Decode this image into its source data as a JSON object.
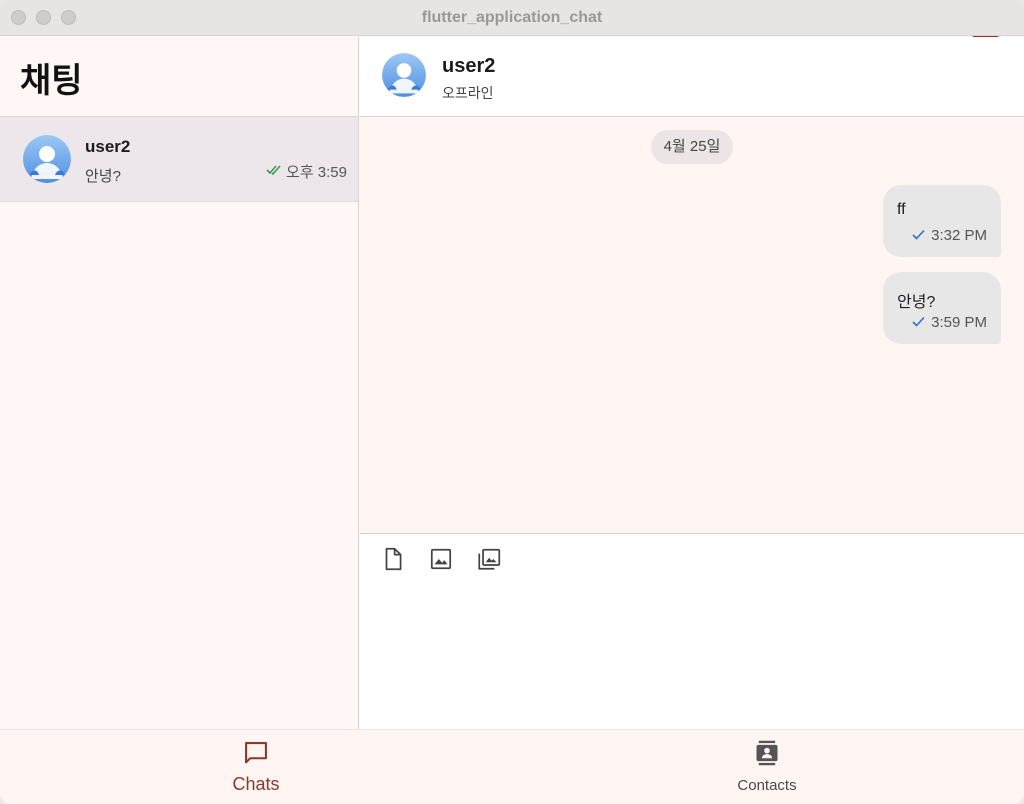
{
  "window": {
    "title": "flutter_application_chat"
  },
  "left_pane": {
    "title": "채팅",
    "chats": [
      {
        "name": "user2",
        "preview": "안녕?",
        "time": "오후 3:59",
        "status_icon": "double-check-icon"
      }
    ]
  },
  "conversation": {
    "name": "user2",
    "status": "오프라인",
    "date_chip": "4월 25일",
    "messages": [
      {
        "text": "ff",
        "time": "3:32 PM",
        "status_icon": "check-icon"
      },
      {
        "text": "안녕?",
        "time": "3:59 PM",
        "status_icon": "check-icon"
      }
    ],
    "composer_tools": [
      "file-icon",
      "image-icon",
      "gallery-icon"
    ]
  },
  "bottom_nav": {
    "items": [
      {
        "label": "Chats",
        "icon": "chat-bubble-icon",
        "active": true
      },
      {
        "label": "Contacts",
        "icon": "contacts-icon",
        "active": false
      }
    ]
  },
  "debug_banner": "DEBUG",
  "colors": {
    "accent": "#8b3a2a",
    "background": "#fff7f5",
    "selected_row": "#ede7ec",
    "bubble": "#e7e7e7",
    "check": "#2f6fd6",
    "double_check": "#3a9a4a",
    "debug": "#a52a2a"
  }
}
